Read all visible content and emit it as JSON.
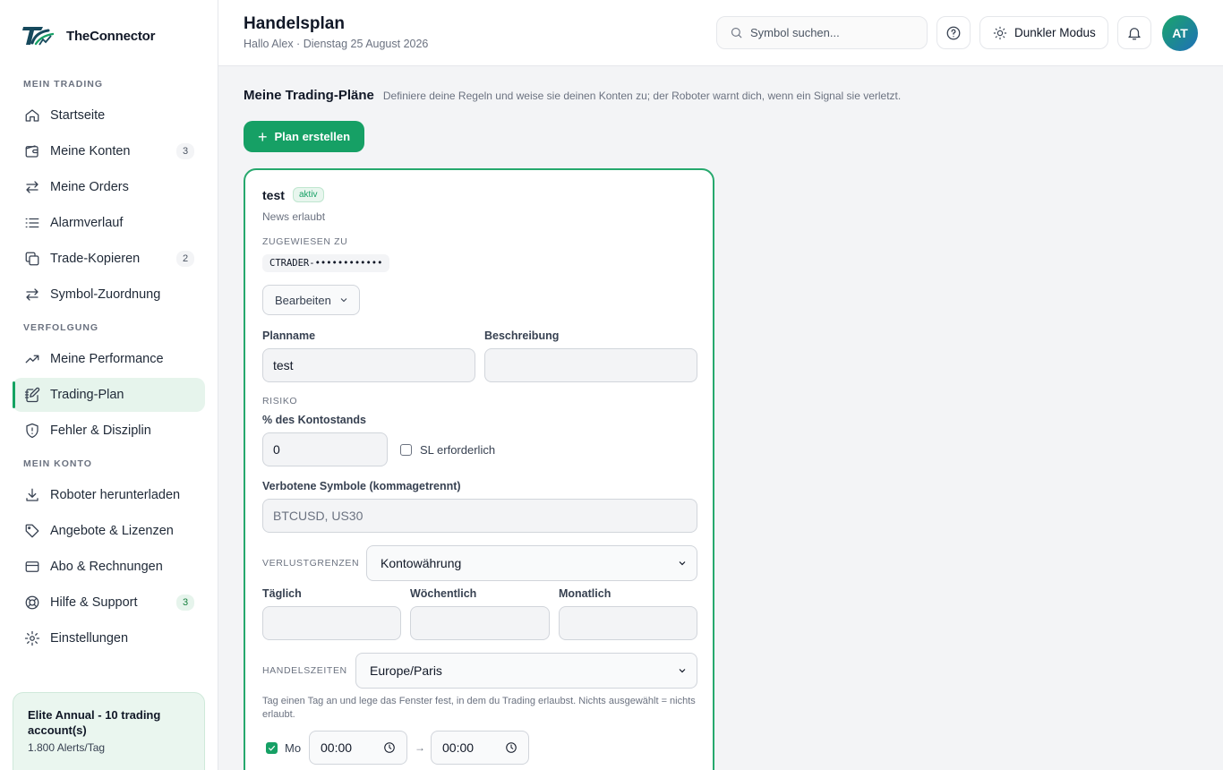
{
  "brand": {
    "name": "TheConnector"
  },
  "sidebar": {
    "sections": [
      {
        "label": "MEIN TRADING"
      },
      {
        "label": "VERFOLGUNG"
      },
      {
        "label": "MEIN KONTO"
      }
    ],
    "items": [
      {
        "label": "Startseite",
        "icon": "home-icon"
      },
      {
        "label": "Meine Konten",
        "icon": "wallet-icon",
        "count": "3"
      },
      {
        "label": "Meine Orders",
        "icon": "swap-arrows-icon"
      },
      {
        "label": "Alarmverlauf",
        "icon": "list-icon"
      },
      {
        "label": "Trade-Kopieren",
        "icon": "copy-icon",
        "count": "2"
      },
      {
        "label": "Symbol-Zuordnung",
        "icon": "swap-arrows-icon"
      },
      {
        "label": "Meine Performance",
        "icon": "trending-up-icon"
      },
      {
        "label": "Trading-Plan",
        "icon": "notebook-pen-icon",
        "active": true
      },
      {
        "label": "Fehler & Disziplin",
        "icon": "shield-icon"
      },
      {
        "label": "Roboter herunterladen",
        "icon": "download-icon"
      },
      {
        "label": "Angebote & Lizenzen",
        "icon": "tag-icon"
      },
      {
        "label": "Abo & Rechnungen",
        "icon": "credit-card-icon"
      },
      {
        "label": "Hilfe & Support",
        "icon": "lifebuoy-icon",
        "count": "3"
      },
      {
        "label": "Einstellungen",
        "icon": "gear-icon"
      }
    ],
    "plan": {
      "title": "Elite Annual - 10 trading account(s)",
      "sub": "1.800 Alerts/Tag"
    }
  },
  "header": {
    "title": "Handelsplan",
    "subtitle": "Hallo Alex · Dienstag 25 August 2026",
    "search_placeholder": "Symbol suchen...",
    "dark_mode_label": "Dunkler Modus",
    "avatar_initials": "AT"
  },
  "main": {
    "section_title": "Meine Trading-Pläne",
    "section_desc": "Definiere deine Regeln und weise sie deinen Konten zu; der Roboter warnt dich, wenn ein Signal sie verletzt.",
    "create_label": "Plan erstellen",
    "plan": {
      "name": "test",
      "status": "aktiv",
      "news": "News erlaubt",
      "assigned_label": "ZUGEWIESEN ZU",
      "assigned_account": "CTRADER-••••••••••••",
      "edit_label": "Bearbeiten",
      "planname_label": "Planname",
      "planname_value": "test",
      "description_label": "Beschreibung",
      "description_value": "",
      "risk_label": "RISIKO",
      "risk_pct_label": "% des Kontostands",
      "risk_pct_value": "0",
      "sl_label": "SL erforderlich",
      "sl_checked": false,
      "forbidden_label": "Verbotene Symbole (kommagetrennt)",
      "forbidden_placeholder": "BTCUSD, US30",
      "loss_limits_label": "VERLUSTGRENZEN",
      "loss_currency": "Kontowährung",
      "daily_label": "Täglich",
      "weekly_label": "Wöchentlich",
      "monthly_label": "Monatlich",
      "hours_label": "HANDELSZEITEN",
      "timezone": "Europe/Paris",
      "hours_hint": "Tag einen Tag an und lege das Fenster fest, in dem du Trading erlaubst. Nichts ausgewählt = nichts erlaubt.",
      "day_label": "Mo",
      "day_checked": true,
      "time_from": "00:00",
      "time_arrow": "→",
      "time_to": "00:00"
    }
  },
  "colors": {
    "accent": "#16a065",
    "active_bg": "#e6f4ec"
  }
}
